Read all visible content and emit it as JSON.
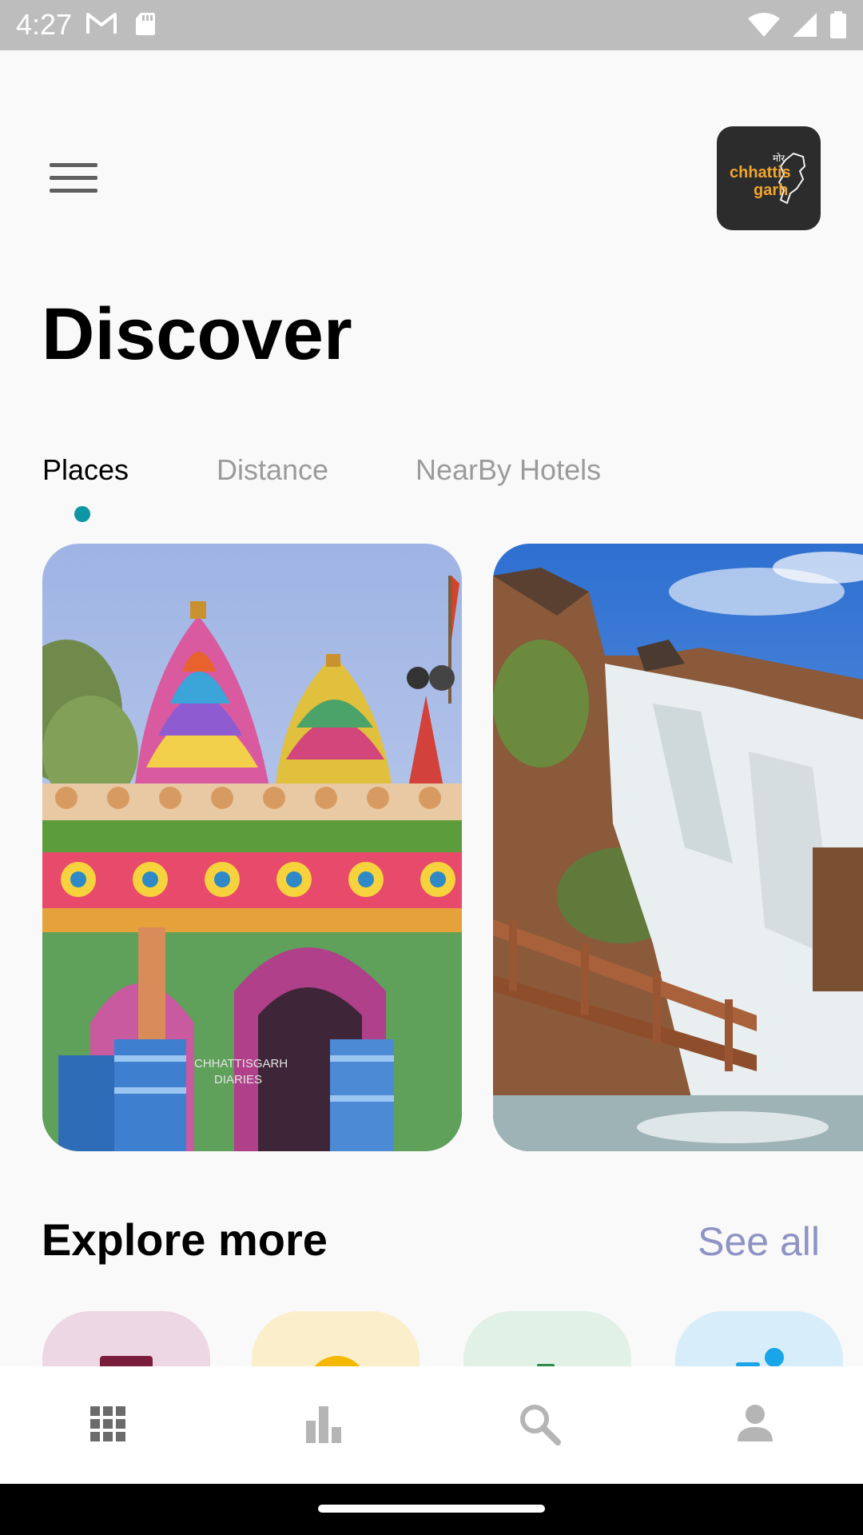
{
  "status_bar": {
    "time": "4:27",
    "left_icons": [
      "gmail-icon",
      "sd-card-icon"
    ],
    "right_icons": [
      "wifi-icon",
      "cell-signal-icon",
      "battery-icon"
    ]
  },
  "header": {
    "menu_icon": "hamburger-menu-icon",
    "logo_alt": "Chhattisgarh"
  },
  "title": "Discover",
  "tabs": [
    {
      "label": "Places",
      "active": true
    },
    {
      "label": "Distance",
      "active": false
    },
    {
      "label": "NearBy Hotels",
      "active": false
    }
  ],
  "cards": [
    {
      "name": "temple",
      "watermark_line1": "CHHATTISGARH",
      "watermark_line2": "DIARIES"
    },
    {
      "name": "waterfall"
    }
  ],
  "explore": {
    "title": "Explore more",
    "see_all": "See all"
  },
  "explore_tiles": [
    {
      "bg": "#ecd7e3"
    },
    {
      "bg": "#fbefcb"
    },
    {
      "bg": "#e2f1e6"
    },
    {
      "bg": "#d7eefa"
    }
  ],
  "bottom_nav": [
    "apps-grid-icon",
    "bar-chart-icon",
    "search-icon",
    "person-icon"
  ],
  "colors": {
    "accent": "#0f96a4",
    "see_all": "#8e92c5",
    "logo_text": "#f0a530"
  }
}
